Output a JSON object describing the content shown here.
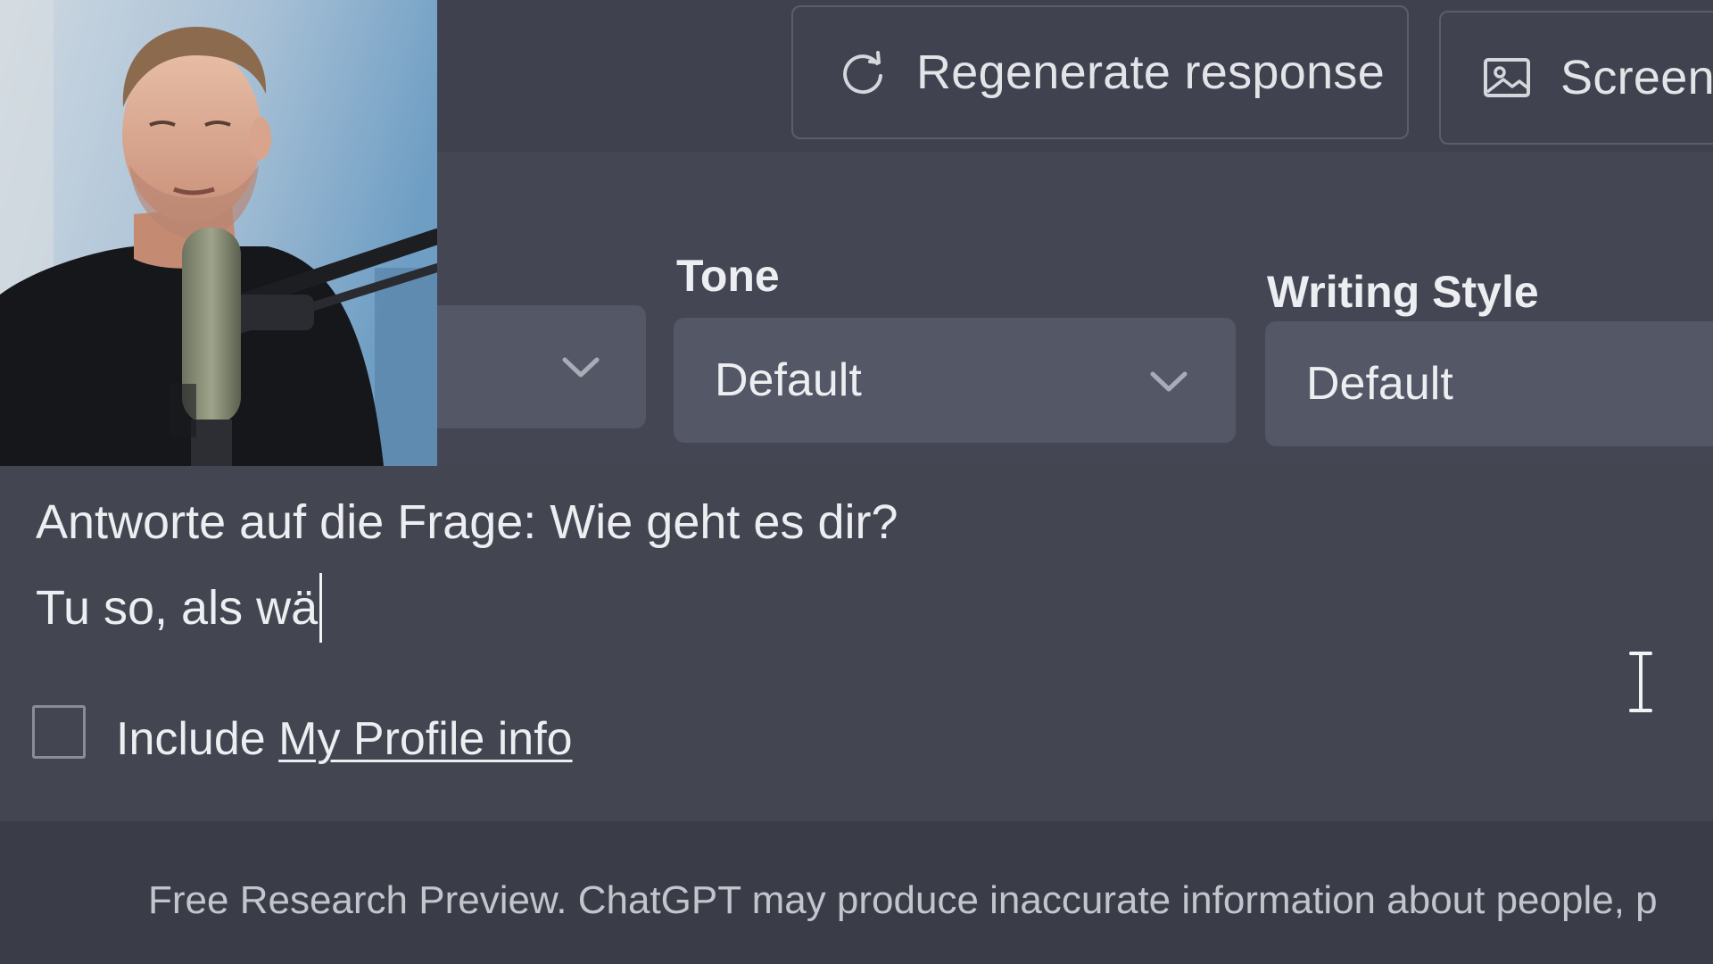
{
  "top_actions": {
    "regenerate_label": "Regenerate response",
    "screenshot_label": "Screens"
  },
  "settings": {
    "tone_label": "Tone",
    "tone_value": "Default",
    "writing_style_label": "Writing Style",
    "writing_style_value": "Default"
  },
  "prompt": {
    "line_1": "Antworte auf die Frage: Wie geht es dir?",
    "line_2": "Tu so, als wä"
  },
  "include_profile": {
    "prefix": "Include",
    "link": "My Profile info",
    "checked": false
  },
  "footer": {
    "disclaimer": "Free Research Preview. ChatGPT may produce inaccurate information about people, p"
  },
  "icons": {
    "regenerate": "refresh-icon",
    "screenshot": "image-icon",
    "dropdown": "chevron-down-icon",
    "text_cursor": "text-cursor-icon"
  },
  "colors": {
    "background": "#444654",
    "topbar": "#3f424e",
    "select_fill": "#545766",
    "text": "#eceef1",
    "footer": "#3a3c47"
  }
}
